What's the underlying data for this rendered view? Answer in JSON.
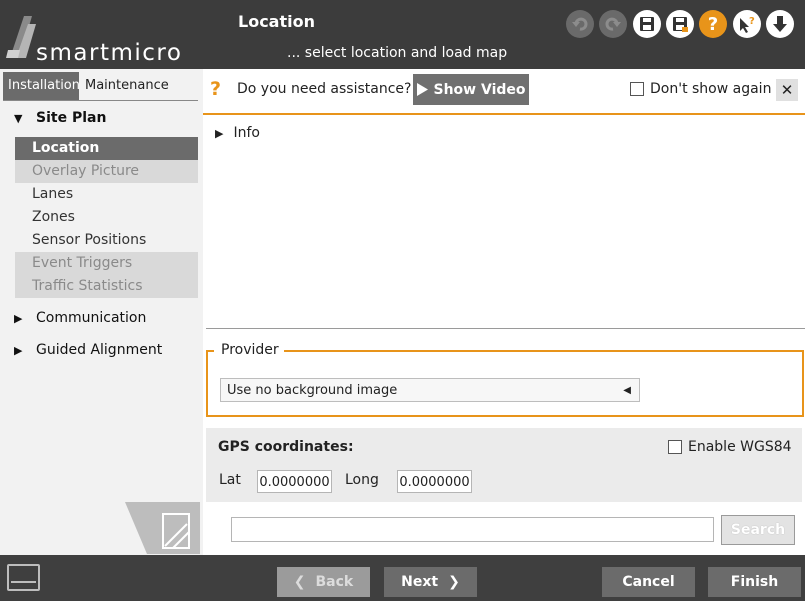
{
  "header": {
    "brand": "smartmicro",
    "title": "Location",
    "subtitle": "... select location and load map",
    "toolbar": [
      {
        "name": "undo-icon",
        "enabled": false
      },
      {
        "name": "redo-icon",
        "enabled": false
      },
      {
        "name": "save-icon",
        "enabled": true
      },
      {
        "name": "save-as-icon",
        "enabled": true
      },
      {
        "name": "help-icon",
        "enabled": true
      },
      {
        "name": "context-help-icon",
        "enabled": true
      },
      {
        "name": "download-icon",
        "enabled": true
      }
    ]
  },
  "sidebar": {
    "tabs": [
      {
        "label": "Installation",
        "active": true
      },
      {
        "label": "Maintenance",
        "active": false
      }
    ],
    "groups": [
      {
        "label": "Site Plan",
        "expanded": true
      },
      {
        "label": "Communication",
        "expanded": false
      },
      {
        "label": "Guided Alignment",
        "expanded": false
      }
    ],
    "items": [
      {
        "label": "Location",
        "state": "selected"
      },
      {
        "label": "Overlay Picture",
        "state": "disabled"
      },
      {
        "label": "Lanes",
        "state": "normal"
      },
      {
        "label": "Zones",
        "state": "normal"
      },
      {
        "label": "Sensor Positions",
        "state": "normal"
      },
      {
        "label": "Event Triggers",
        "state": "disabled"
      },
      {
        "label": "Traffic Statistics",
        "state": "disabled"
      }
    ]
  },
  "assist": {
    "question": "Do you need assistance?",
    "show_video": "Show Video",
    "dont_show": "Don't show again",
    "dont_show_checked": false
  },
  "info": {
    "label": "Info"
  },
  "provider": {
    "legend": "Provider",
    "selected": "Use no background image"
  },
  "gps": {
    "title": "GPS coordinates",
    "colon": ":",
    "wgs_label": "Enable WGS84",
    "wgs_checked": false,
    "lat_label": "Lat",
    "lat_value": "0.0000000",
    "long_label": "Long",
    "long_value": "0.0000000"
  },
  "search": {
    "value": "",
    "button": "Search"
  },
  "footer": {
    "back": "Back",
    "next": "Next",
    "cancel": "Cancel",
    "finish": "Finish"
  },
  "colors": {
    "accent": "#e8941a",
    "header_bg": "#3c3c3c",
    "selected_bg": "#6b6b6b"
  }
}
